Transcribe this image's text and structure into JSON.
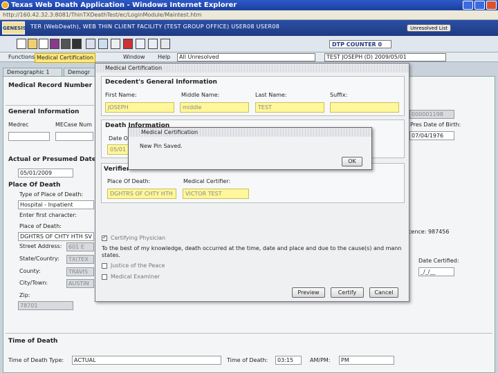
{
  "window": {
    "title": "Texas Web Death Application - Windows Internet Explorer",
    "address": "http://160.42.32.3:8081/ThinTXDeathTest/ec/LoginModule/Maintest.htm"
  },
  "header": {
    "logo": "GENESIS",
    "title": "TER (WebDeath), WEB THIN CLIENT FACILITY (TEST GROUP OFFICE) USER08 USER08",
    "unresolved_label": "Unresolved List"
  },
  "toolbar": {
    "dtp_counter": "DTP COUNTER 0",
    "icons": [
      "new-icon",
      "open-icon",
      "edit-icon",
      "save-icon",
      "print-icon",
      "binoculars-icon",
      "tools-icon",
      "settings-icon",
      "pen-icon",
      "no-icon",
      "form-icon",
      "certificate-icon",
      "hand-icon"
    ]
  },
  "menu": {
    "functions": "Functions",
    "medcert": "Medical Certification",
    "window": "Window",
    "help": "Help",
    "filter": "All Unresolved",
    "case": "TEST JOSEPH (D) 2009/05/01"
  },
  "tabs": {
    "demo1": "Demographic 1",
    "demo2": "Demogr"
  },
  "bg": {
    "medrec_label": "Medical Record Number",
    "general_info": "General Information",
    "medrec": "Medrec",
    "mecase": "MECase Num",
    "actual_date_label": "Actual or Presumed Date o",
    "actual_date": "05/01/2009",
    "place_of_death": "Place Of Death",
    "type_place_label": "Type of Place of Death:",
    "type_place_value": "Hospital - Inpatient",
    "enter_first": "Enter first character:",
    "place_label": "Place of Death:",
    "place_value": "DGHTRS OF CHTY HTH SV",
    "street_label": "Street Address:",
    "street_value": "601 E",
    "state_label": "State/Country:",
    "state_value": "TX(TEX",
    "county_label": "County:",
    "county_value": "TRAVIS",
    "city_label": "City/Town:",
    "city_value": "AUSTIN",
    "zip_label": "Zip:",
    "zip_value": "78701",
    "ssn_value": "000001198",
    "pres_dob_label": "Pres Date of Birth:",
    "dob_value": "07/04/1976",
    "license_text": "cence: 987456",
    "date_cert_label": "Date Certified:",
    "date_cert_value": "_/_/__",
    "time_of_death": "Time of Death",
    "tod_type_label": "Time of Death Type:",
    "tod_type_value": "ACTUAL",
    "tod_label": "Time of Death:",
    "tod_value": "03:15",
    "ampm_label": "AM/PM:",
    "ampm_value": "PM"
  },
  "medcert": {
    "title": "Medical Certification",
    "decedent_header": "Decedent's General Information",
    "first_name_label": "First Name:",
    "middle_name_label": "Middle Name:",
    "last_name_label": "Last Name:",
    "suffix_label": "Suffix:",
    "first_name": "JOSEPH",
    "middle_name": "middle",
    "last_name": "TEST",
    "suffix": "",
    "death_info_header": "Death Information",
    "date_of_label": "Date Of",
    "date_of_value": "05/01",
    "verifier_header": "Verifier",
    "place_of_death_label": "Place Of Death:",
    "med_certifier_label": "Medical Certifier:",
    "place_of_death": "DGHTRS OF CHTY HTH",
    "med_certifier": "VICTOR TEST",
    "certifying_physician": "Certifying Physician",
    "statement": "To the best of my knowledge, death occurred at the time, date and place and due to the cause(s) and mann states.",
    "justice": "Justice of the Peace",
    "medical_examiner": "Medical Examiner",
    "preview": "Preview",
    "certify": "Certify",
    "cancel": "Cancel"
  },
  "popup": {
    "title": "Medical Certification",
    "message": "New Pin Saved.",
    "ok": "OK"
  }
}
